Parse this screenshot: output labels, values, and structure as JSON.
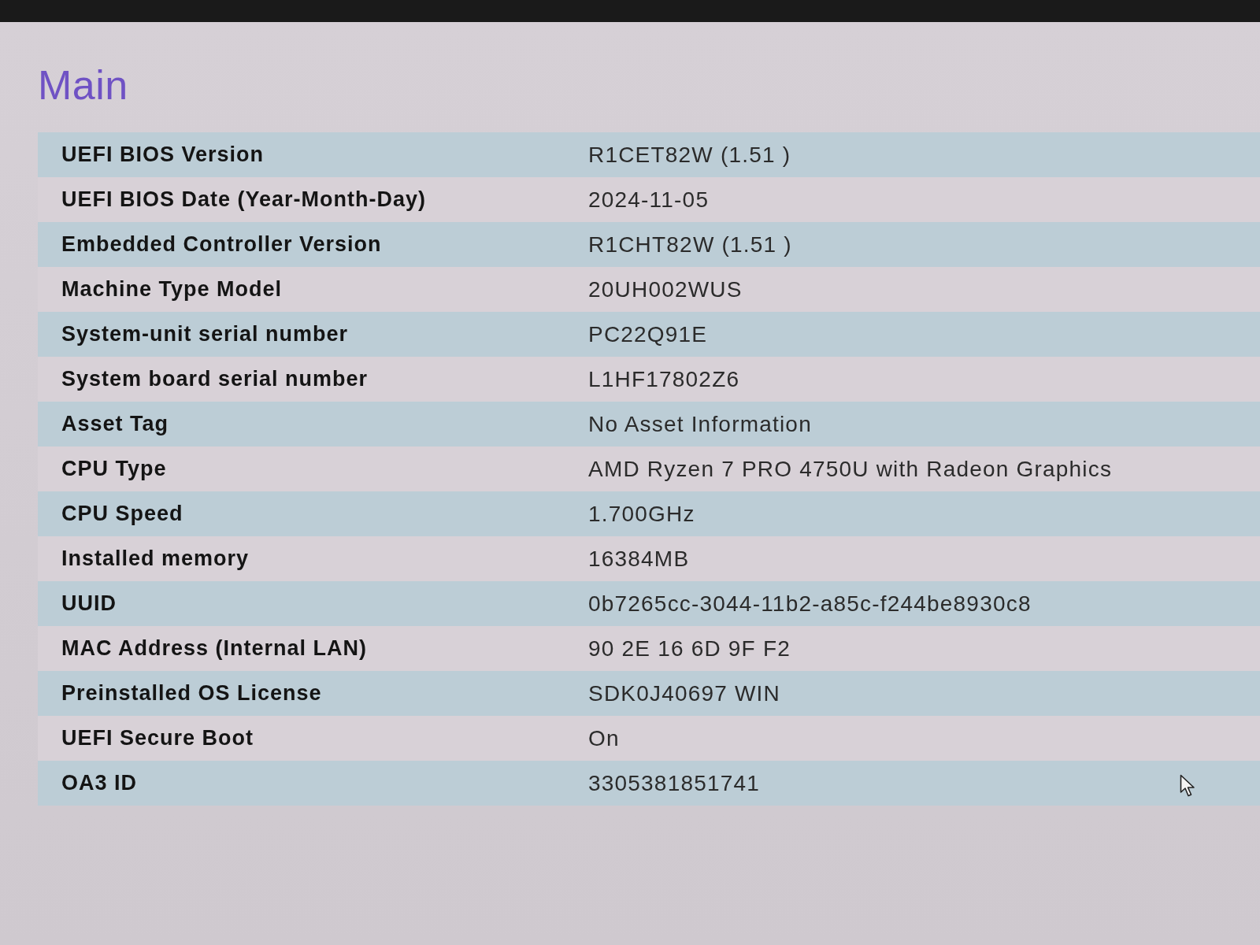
{
  "page": {
    "title": "Main"
  },
  "rows": [
    {
      "label": "UEFI BIOS Version",
      "value": "R1CET82W (1.51 )"
    },
    {
      "label": "UEFI BIOS Date (Year-Month-Day)",
      "value": "2024-11-05"
    },
    {
      "label": "Embedded Controller Version",
      "value": "R1CHT82W (1.51 )"
    },
    {
      "label": "Machine Type Model",
      "value": "20UH002WUS"
    },
    {
      "label": "System-unit serial number",
      "value": "PC22Q91E"
    },
    {
      "label": "System board serial number",
      "value": "L1HF17802Z6"
    },
    {
      "label": "Asset Tag",
      "value": "No Asset Information"
    },
    {
      "label": "CPU Type",
      "value": "AMD Ryzen 7 PRO 4750U with Radeon Graphics"
    },
    {
      "label": "CPU Speed",
      "value": "1.700GHz"
    },
    {
      "label": "Installed memory",
      "value": "16384MB"
    },
    {
      "label": "UUID",
      "value": "0b7265cc-3044-11b2-a85c-f244be8930c8"
    },
    {
      "label": "MAC Address (Internal LAN)",
      "value": "90 2E 16 6D 9F F2"
    },
    {
      "label": "Preinstalled OS License",
      "value": "SDK0J40697 WIN"
    },
    {
      "label": "UEFI Secure Boot",
      "value": "On"
    },
    {
      "label": "OA3 ID",
      "value": "3305381851741"
    }
  ]
}
